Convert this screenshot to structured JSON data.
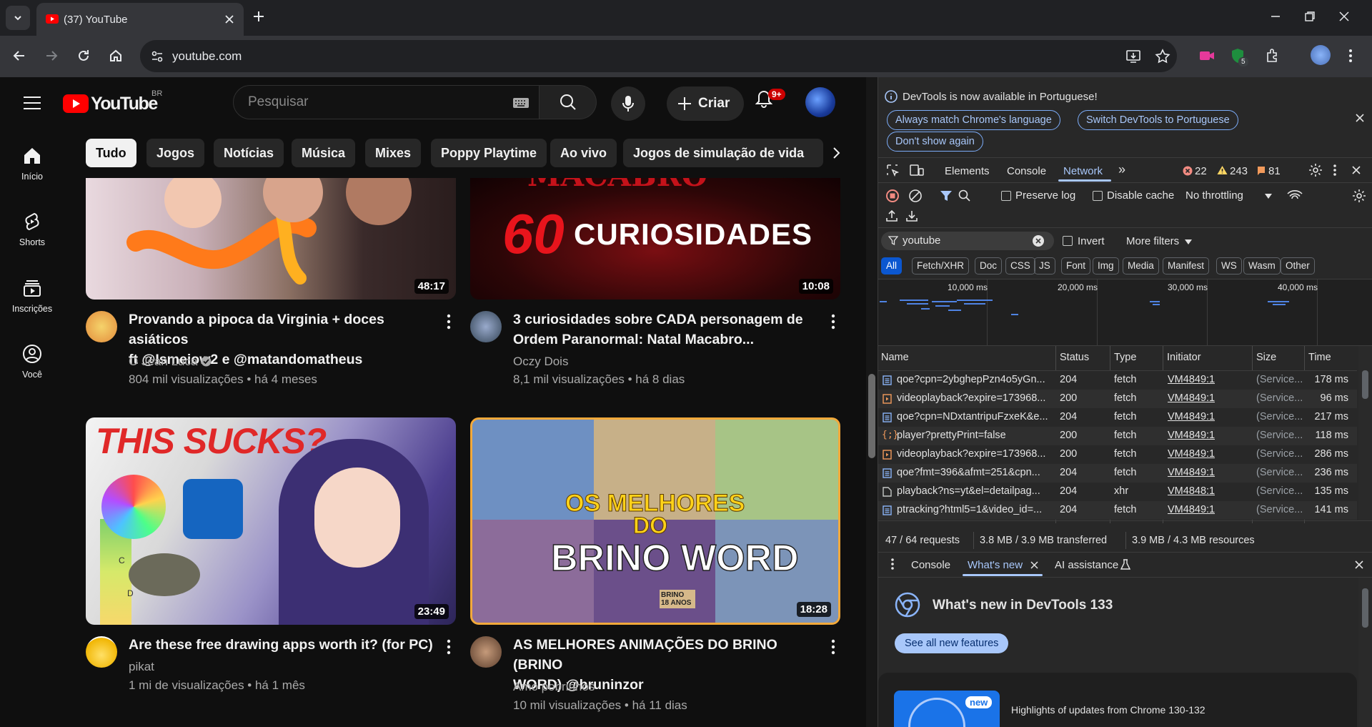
{
  "browser": {
    "tab_title": "(37) YouTube",
    "url": "youtube.com",
    "extension_badge": "5"
  },
  "youtube": {
    "region": "BR",
    "logo_text": "YouTube",
    "search_placeholder": "Pesquisar",
    "create_label": "Criar",
    "notification_count": "9+",
    "sidebar": [
      {
        "label": "Início",
        "icon": "home-icon"
      },
      {
        "label": "Shorts",
        "icon": "shorts-icon"
      },
      {
        "label": "Inscrições",
        "icon": "subscriptions-icon"
      },
      {
        "label": "Você",
        "icon": "you-icon"
      }
    ],
    "chips": [
      "Tudo",
      "Jogos",
      "Notícias",
      "Música",
      "Mixes",
      "Poppy Playtime",
      "Ao vivo",
      "Jogos de simulação de vida"
    ],
    "videos": [
      {
        "title_line1": "Provando a pipoca da Virginia + doces asiáticos",
        "title_line2": "ft @Ismeiow2 e @matandomatheus",
        "channel": "O Jean Luca",
        "meta": "804 mil visualizações • há 4 meses",
        "duration": "48:17"
      },
      {
        "title_line1": "3 curiosidades sobre CADA personagem de",
        "title_line2": "Ordem Paranormal: Natal Macabro...",
        "channel": "Oczy Dois",
        "meta": "8,1 mil visualizações • há 8 dias",
        "duration": "10:08",
        "thumb_text": "CURIOSIDADES",
        "thumb_number": "60",
        "thumb_top_text": "MACABRO"
      },
      {
        "title_line1": "Are these free drawing apps worth it? (for PC)",
        "title_line2": "",
        "channel": "pikat",
        "meta": "1 mi de visualizações • há 1 mês",
        "duration": "23:49",
        "thumb_text": "THIS SUCKS?",
        "tier_labels": [
          "C",
          "D"
        ]
      },
      {
        "title_line1": "AS MELHORES ANIMAÇÕES DO BRINO (BRINO",
        "title_line2": "WORD) @bruninzor",
        "channel": "Amo pobrinhos",
        "meta": "10 mil visualizações • há 11 dias",
        "duration": "18:28",
        "thumb_line1": "OS MELHORES",
        "thumb_line2": "DO",
        "thumb_line3": "BRINO WORD",
        "sign_text": "BRINO 18 ANOS"
      }
    ]
  },
  "devtools": {
    "info_message": "DevTools is now available in Portuguese!",
    "info_buttons": [
      "Always match Chrome's language",
      "Switch DevTools to Portuguese",
      "Don't show again"
    ],
    "tabs": [
      "Elements",
      "Console",
      "Network"
    ],
    "active_tab": "Network",
    "errors": "22",
    "warnings": "243",
    "issues": "81",
    "preserve_log": "Preserve log",
    "disable_cache": "Disable cache",
    "throttling": "No throttling",
    "filter_value": "youtube",
    "invert_label": "Invert",
    "more_filters": "More filters",
    "type_filters": [
      "All",
      "Fetch/XHR",
      "Doc",
      "CSS",
      "JS",
      "Font",
      "Img",
      "Media",
      "Manifest",
      "WS",
      "Wasm",
      "Other"
    ],
    "timeline_ticks": [
      "10,000 ms",
      "20,000 ms",
      "30,000 ms",
      "40,000 ms"
    ],
    "columns": [
      "Name",
      "Status",
      "Type",
      "Initiator",
      "Size",
      "Time"
    ],
    "requests": [
      {
        "name": "qoe?cpn=2ybghepPzn4o5yGn...",
        "status": "204",
        "type": "fetch",
        "initiator": "VM4849:1",
        "size": "(Service...",
        "time": "178 ms",
        "icon": "doc"
      },
      {
        "name": "videoplayback?expire=173968...",
        "status": "200",
        "type": "fetch",
        "initiator": "VM4849:1",
        "size": "(Service...",
        "time": "96 ms",
        "icon": "media"
      },
      {
        "name": "qoe?cpn=NDxtantripuFzxeK&e...",
        "status": "204",
        "type": "fetch",
        "initiator": "VM4849:1",
        "size": "(Service...",
        "time": "217 ms",
        "icon": "doc"
      },
      {
        "name": "player?prettyPrint=false",
        "status": "200",
        "type": "fetch",
        "initiator": "VM4849:1",
        "size": "(Service...",
        "time": "118 ms",
        "icon": "json"
      },
      {
        "name": "videoplayback?expire=173968...",
        "status": "200",
        "type": "fetch",
        "initiator": "VM4849:1",
        "size": "(Service...",
        "time": "286 ms",
        "icon": "media"
      },
      {
        "name": "qoe?fmt=396&afmt=251&cpn...",
        "status": "204",
        "type": "fetch",
        "initiator": "VM4849:1",
        "size": "(Service...",
        "time": "236 ms",
        "icon": "doc"
      },
      {
        "name": "playback?ns=yt&el=detailpag...",
        "status": "204",
        "type": "xhr",
        "initiator": "VM4848:1",
        "size": "(Service...",
        "time": "135 ms",
        "icon": "file"
      },
      {
        "name": "ptracking?html5=1&video_id=...",
        "status": "204",
        "type": "fetch",
        "initiator": "VM4849:1",
        "size": "(Service...",
        "time": "141 ms",
        "icon": "doc"
      }
    ],
    "summary": [
      "47 / 64 requests",
      "3.8 MB / 3.9 MB transferred",
      "3.9 MB / 4.3 MB resources"
    ],
    "drawer_tabs": [
      "Console",
      "What's new",
      "AI assistance"
    ],
    "whatsnew_title": "What's new in DevTools 133",
    "see_all": "See all new features",
    "new_badge": "new",
    "highlight_text": "Highlights of updates from Chrome 130-132"
  }
}
